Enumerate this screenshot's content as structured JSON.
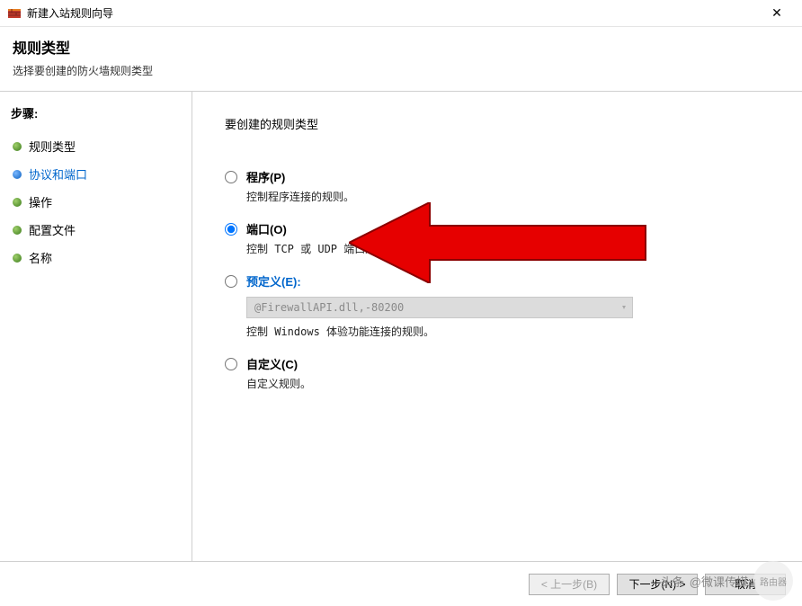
{
  "window": {
    "title": "新建入站规则向导",
    "close_glyph": "✕"
  },
  "header": {
    "title": "规则类型",
    "subtitle": "选择要创建的防火墙规则类型"
  },
  "sidebar": {
    "steps_label": "步骤:",
    "items": [
      {
        "label": "规则类型",
        "active": false
      },
      {
        "label": "协议和端口",
        "active": true
      },
      {
        "label": "操作",
        "active": false
      },
      {
        "label": "配置文件",
        "active": false
      },
      {
        "label": "名称",
        "active": false
      }
    ]
  },
  "main": {
    "section_title": "要创建的规则类型",
    "options": [
      {
        "key": "program",
        "label": "程序(P)",
        "desc": "控制程序连接的规则。",
        "selected": false
      },
      {
        "key": "port",
        "label": "端口(O)",
        "desc": "控制 TCP 或 UDP 端口连接的规则。",
        "selected": true
      },
      {
        "key": "predefined",
        "label": "预定义(E):",
        "desc": "控制 Windows 体验功能连接的规则。",
        "selected": false,
        "dropdown_value": "@FirewallAPI.dll,-80200"
      },
      {
        "key": "custom",
        "label": "自定义(C)",
        "desc": "自定义规则。",
        "selected": false
      }
    ]
  },
  "footer": {
    "back_label": "< 上一步(B)",
    "next_label": "下一步(N) >",
    "cancel_label": "取消"
  },
  "watermark": {
    "text1": "头条",
    "text2": "@微课传媒",
    "badge": "路由器"
  }
}
